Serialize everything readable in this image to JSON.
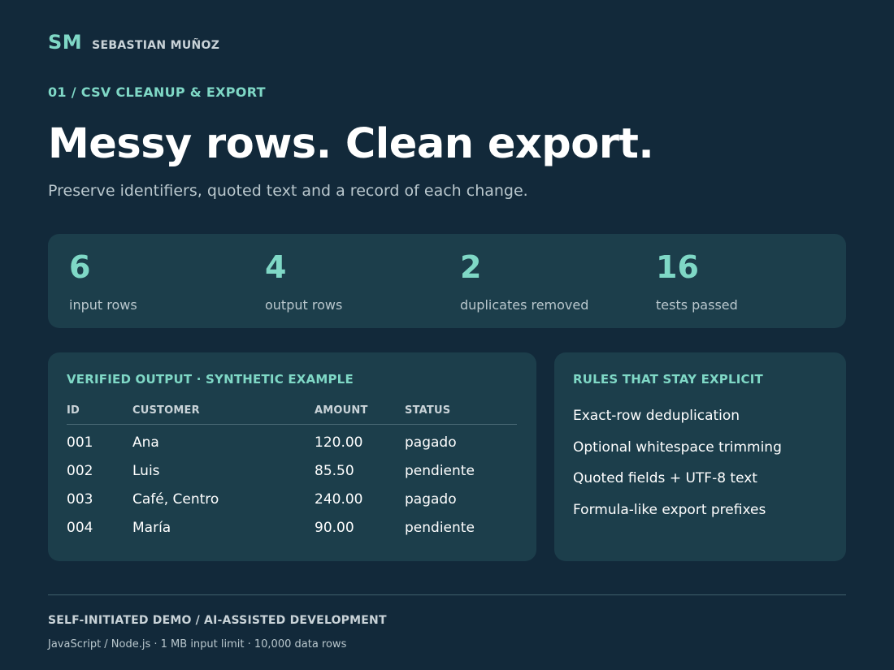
{
  "brand": {
    "monogram": "SM",
    "name": "SEBASTIAN MUÑOZ"
  },
  "hero": {
    "eyebrow": "01 / CSV CLEANUP & EXPORT",
    "title": "Messy rows. Clean export.",
    "subtitle": "Preserve identifiers, quoted text and a record of each change."
  },
  "stats": [
    {
      "value": "6",
      "label": "input rows"
    },
    {
      "value": "4",
      "label": "output rows"
    },
    {
      "value": "2",
      "label": "duplicates removed"
    },
    {
      "value": "16",
      "label": "tests passed"
    }
  ],
  "output": {
    "title": "VERIFIED OUTPUT · SYNTHETIC EXAMPLE",
    "columns": [
      "ID",
      "CUSTOMER",
      "AMOUNT",
      "STATUS"
    ],
    "rows": [
      [
        "001",
        "Ana",
        "120.00",
        "pagado"
      ],
      [
        "002",
        "Luis",
        "85.50",
        "pendiente"
      ],
      [
        "003",
        "Café, Centro",
        "240.00",
        "pagado"
      ],
      [
        "004",
        "María",
        "90.00",
        "pendiente"
      ]
    ]
  },
  "rules": {
    "title": "RULES THAT STAY EXPLICIT",
    "items": [
      "Exact-row deduplication",
      "Optional whitespace trimming",
      "Quoted fields + UTF-8 text",
      "Formula-like export prefixes"
    ]
  },
  "footer": {
    "title": "SELF-INITIATED DEMO / AI-ASSISTED DEVELOPMENT",
    "meta": "JavaScript / Node.js · 1 MB input limit · 10,000 data rows"
  },
  "colors": {
    "background": "#12293a",
    "card": "#1c3e4b",
    "accent": "#7fd8c6"
  }
}
